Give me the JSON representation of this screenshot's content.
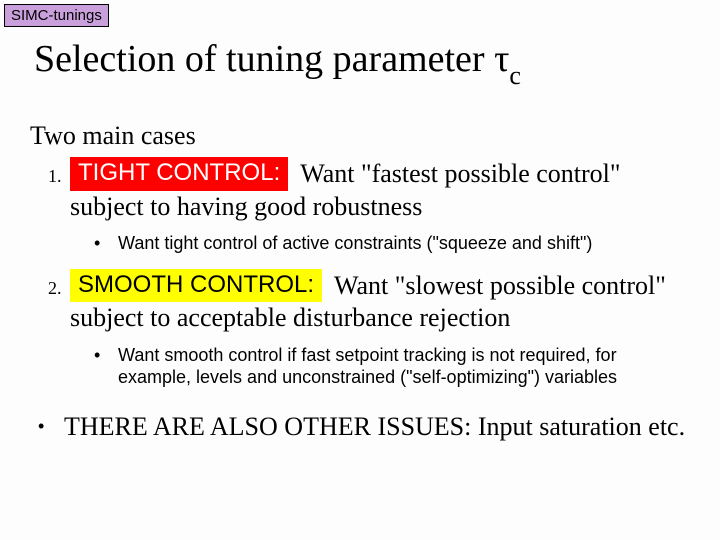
{
  "tag": "SIMC-tunings",
  "title_prefix": "Selection of tuning parameter",
  "title_symbol": "τ",
  "title_subscript": "c",
  "intro": "Two main cases",
  "items": [
    {
      "pill": "TIGHT CONTROL:",
      "pill_class": "red",
      "text_after": " Want \"fastest possible control\" subject to having good robustness",
      "sub": "Want tight control of active constraints (\"squeeze and shift\")"
    },
    {
      "pill": "SMOOTH CONTROL:",
      "pill_class": "yellow",
      "text_after": " Want \"slowest possible control\" subject to acceptable disturbance rejection",
      "sub": "Want smooth control if fast setpoint tracking is not required, for example, levels and unconstrained (\"self-optimizing\") variables"
    }
  ],
  "bottom": "THERE ARE ALSO OTHER ISSUES: Input saturation etc."
}
